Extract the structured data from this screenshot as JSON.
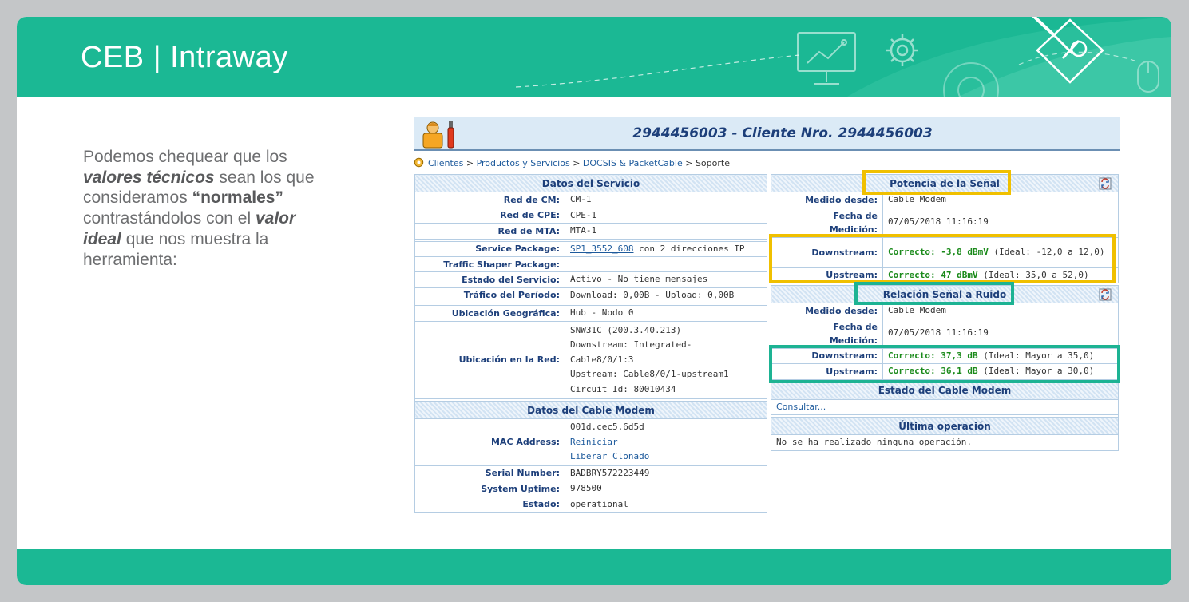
{
  "slide": {
    "title": "CEB | Intraway",
    "body": {
      "p1": "Podemos chequear que los",
      "p2a": "valores técnicos",
      "p2b": " sean los que",
      "p3a": "consideramos ",
      "p3b": "“normales”",
      "p4a": "contrastándolos con el ",
      "p4b": "valor",
      "p5a": "ideal",
      "p5b": " que nos muestra la",
      "p6": "herramienta:"
    },
    "colors": {
      "brand": "#1bb894",
      "highlight_yellow": "#f0c000",
      "highlight_teal": "#1db393",
      "frame": "#c4c6c8"
    }
  },
  "screenshot": {
    "client_title": "2944456003 - Cliente Nro. 2944456003",
    "breadcrumb": {
      "items": [
        "Clientes",
        "Productos y Servicios",
        "DOCSIS & PacketCable"
      ],
      "sep": " > ",
      "current": "Soporte"
    },
    "servicio": {
      "header": "Datos del Servicio",
      "red_cm": {
        "label": "Red de CM:",
        "value": "CM-1"
      },
      "red_cpe": {
        "label": "Red de CPE:",
        "value": "CPE-1"
      },
      "red_mta": {
        "label": "Red de MTA:",
        "value": "MTA-1"
      },
      "service_package": {
        "label": "Service Package:",
        "link": "SP1_3552_608",
        "value": " con 2 direcciones IP"
      },
      "traffic_shaper": {
        "label": "Traffic Shaper Package:",
        "value": ""
      },
      "estado": {
        "label": "Estado del Servicio:",
        "value": "Activo - No tiene mensajes"
      },
      "trafico": {
        "label": "Tráfico del Período:",
        "value": "Download: 0,00B - Upload: 0,00B"
      },
      "ubic_geo": {
        "label": "Ubicación Geográfica:",
        "value": "Hub - Nodo 0"
      },
      "ubic_red": {
        "label": "Ubicación en la Red:",
        "l1": "SNW31C (200.3.40.213)",
        "l2": "Downstream: Integrated-",
        "l3": "Cable8/0/1:3",
        "l4": "Upstream: Cable8/0/1-upstream1",
        "l5": "Circuit Id: 80010434"
      }
    },
    "cable_modem": {
      "header": "Datos del Cable Modem",
      "mac": {
        "label": "MAC Address:",
        "value": "001d.cec5.6d5d",
        "link1": "Reiniciar",
        "link2": "Liberar Clonado"
      },
      "serial": {
        "label": "Serial Number:",
        "value": "BADBRY572223449"
      },
      "uptime": {
        "label": "System Uptime:",
        "value": "978500"
      },
      "estado": {
        "label": "Estado:",
        "value": "operational"
      }
    },
    "potencia": {
      "header": "Potencia de la Señal",
      "medido": {
        "label": "Medido desde:",
        "value": "Cable Modem"
      },
      "fecha": {
        "label1": "Fecha de",
        "label2": "Medición:",
        "value": "07/05/2018 11:16:19"
      },
      "downstream": {
        "label": "Downstream:",
        "status": "Correcto: -3,8 dBmV",
        "ideal": " (Ideal: -12,0 a 12,0)"
      },
      "upstream": {
        "label": "Upstream:",
        "status": "Correcto: 47 dBmV",
        "ideal": " (Ideal: 35,0 a 52,0)"
      }
    },
    "snr": {
      "header": "Relación Señal a Ruido",
      "medido": {
        "label": "Medido desde:",
        "value": "Cable Modem"
      },
      "fecha": {
        "label1": "Fecha de",
        "label2": "Medición:",
        "value": "07/05/2018 11:16:19"
      },
      "downstream": {
        "label": "Downstream:",
        "status": "Correcto: 37,3 dB",
        "ideal": " (Ideal: Mayor a 35,0)"
      },
      "upstream": {
        "label": "Upstream:",
        "status": "Correcto: 36,1 dB",
        "ideal": " (Ideal: Mayor a 30,0)"
      }
    },
    "estado_cm": {
      "header": "Estado del Cable Modem",
      "link": "Consultar..."
    },
    "ultima_op": {
      "header": "Última operación",
      "value": "No se ha realizado ninguna operación."
    }
  }
}
